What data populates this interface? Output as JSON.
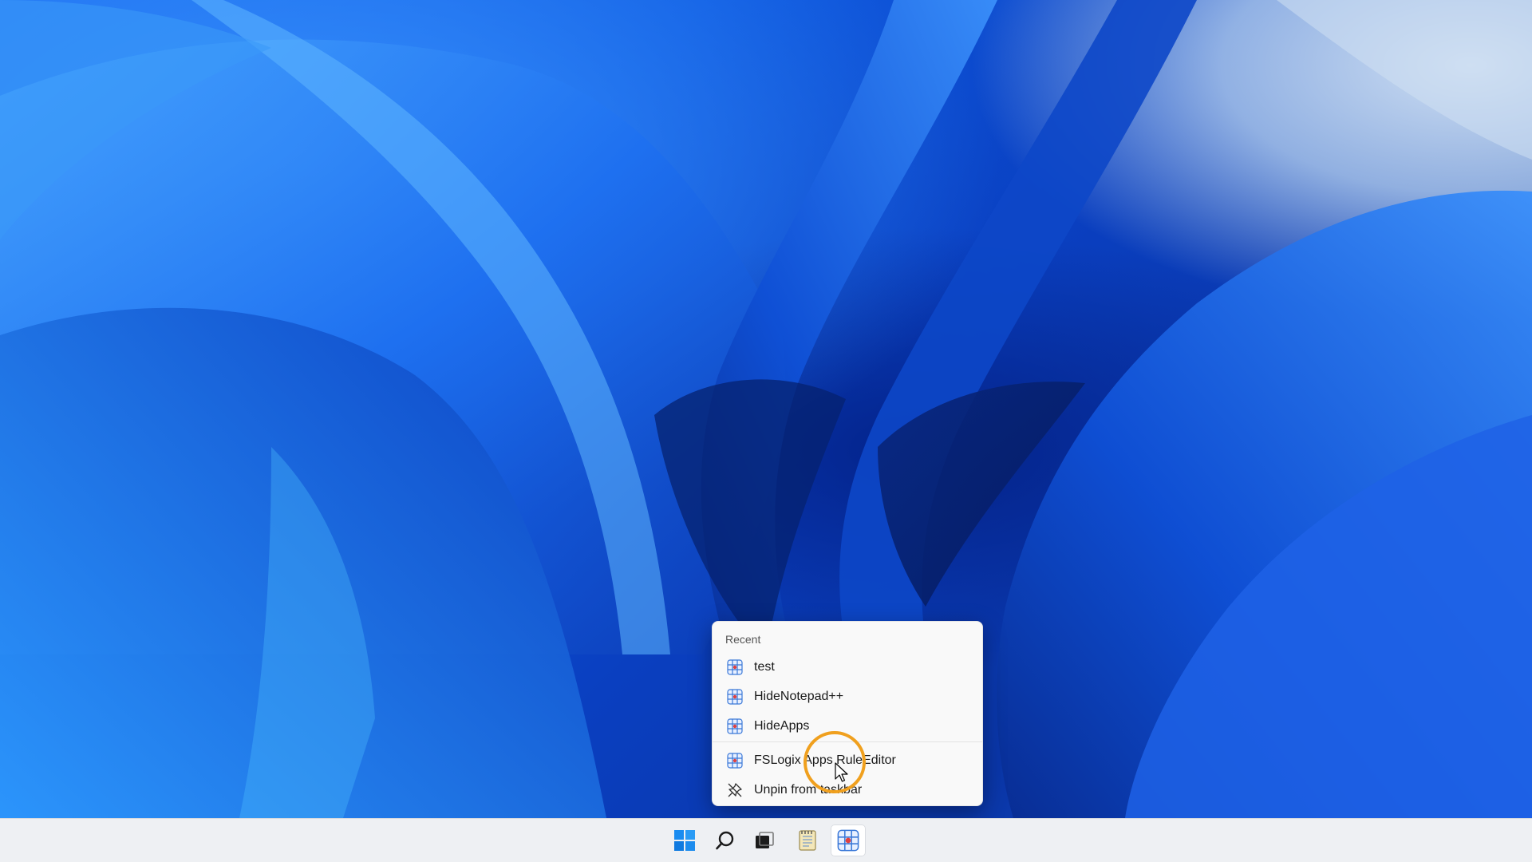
{
  "context_menu": {
    "section_label": "Recent",
    "items": [
      {
        "label": "test",
        "icon": "rule-editor-icon"
      },
      {
        "label": "HideNotepad++",
        "icon": "rule-editor-icon"
      },
      {
        "label": "HideApps",
        "icon": "rule-editor-icon"
      },
      {
        "label": "FSLogix Apps RuleEditor",
        "icon": "rule-editor-icon"
      },
      {
        "label": "Unpin from taskbar",
        "icon": "unpin-icon"
      }
    ]
  },
  "taskbar": {
    "icons": [
      "windows-start-icon",
      "search-icon",
      "task-view-icon",
      "notepad-icon",
      "rule-editor-icon"
    ],
    "active_index": 4
  },
  "colors": {
    "accent": "#0078d4",
    "highlight_ring": "#f0a01e",
    "taskbar_bg": "#eef0f3",
    "menu_bg": "#f9f9f9"
  }
}
